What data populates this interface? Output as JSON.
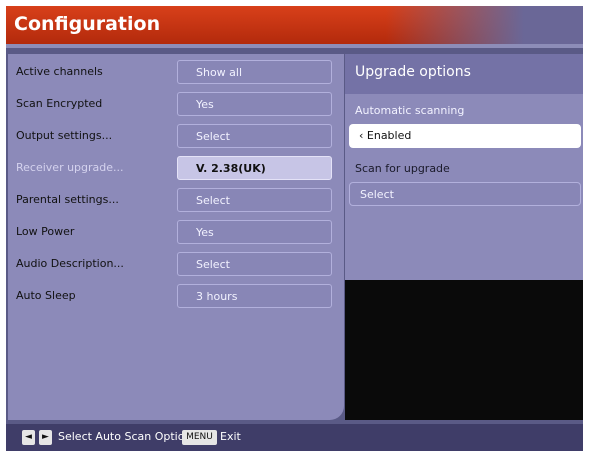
{
  "title": "Configuration",
  "settings": [
    {
      "label": "Active channels",
      "value": "Show all"
    },
    {
      "label": "Scan Encrypted",
      "value": "Yes"
    },
    {
      "label": "Output settings...",
      "value": "Select"
    },
    {
      "label": "Receiver upgrade...",
      "value": "V. 2.38(UK)",
      "state": "disabled"
    },
    {
      "label": "Parental settings...",
      "value": "Select"
    },
    {
      "label": "Low Power",
      "value": "Yes"
    },
    {
      "label": "Audio Description...",
      "value": "Select"
    },
    {
      "label": "Auto Sleep",
      "value": "3 hours"
    }
  ],
  "upgrade_panel": {
    "title": "Upgrade options",
    "automatic_scanning_label": "Automatic scanning",
    "automatic_scanning_value": "‹ Enabled",
    "scan_for_upgrade_label": "Scan for upgrade",
    "scan_for_upgrade_value": "Select"
  },
  "footer": {
    "left_key": "◄",
    "right_key": "►",
    "select_text": "Select Auto Scan Option",
    "menu_key": "MENU",
    "exit_text": "Exit"
  },
  "colors": {
    "title_bar": "#c8351a",
    "panel": "#8c8ab9",
    "background": "#5a5a86",
    "footer": "#3f3d68"
  }
}
